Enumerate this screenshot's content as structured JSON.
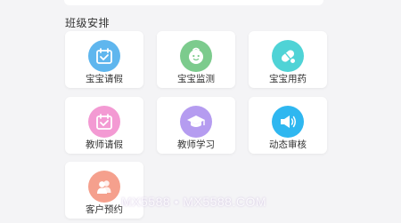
{
  "section": {
    "title": "班级安排"
  },
  "tiles": [
    {
      "label": "宝宝请假",
      "icon": "calendar-check-icon",
      "color": "#5fb6ee"
    },
    {
      "label": "宝宝监测",
      "icon": "baby-face-icon",
      "color": "#7ccb8d"
    },
    {
      "label": "宝宝用药",
      "icon": "pill-capsule-icon",
      "color": "#4fd3d6"
    },
    {
      "label": "教师请假",
      "icon": "calendar-check-icon",
      "color": "#f39ad3"
    },
    {
      "label": "教师学习",
      "icon": "graduation-cap-icon",
      "color": "#b59cf0"
    },
    {
      "label": "动态审核",
      "icon": "megaphone-icon",
      "color": "#2fb7f0"
    },
    {
      "label": "客户预约",
      "icon": "users-icon",
      "color": "#f5a08d"
    }
  ],
  "watermark": {
    "text": "MX5588 • MX5588.COM"
  }
}
